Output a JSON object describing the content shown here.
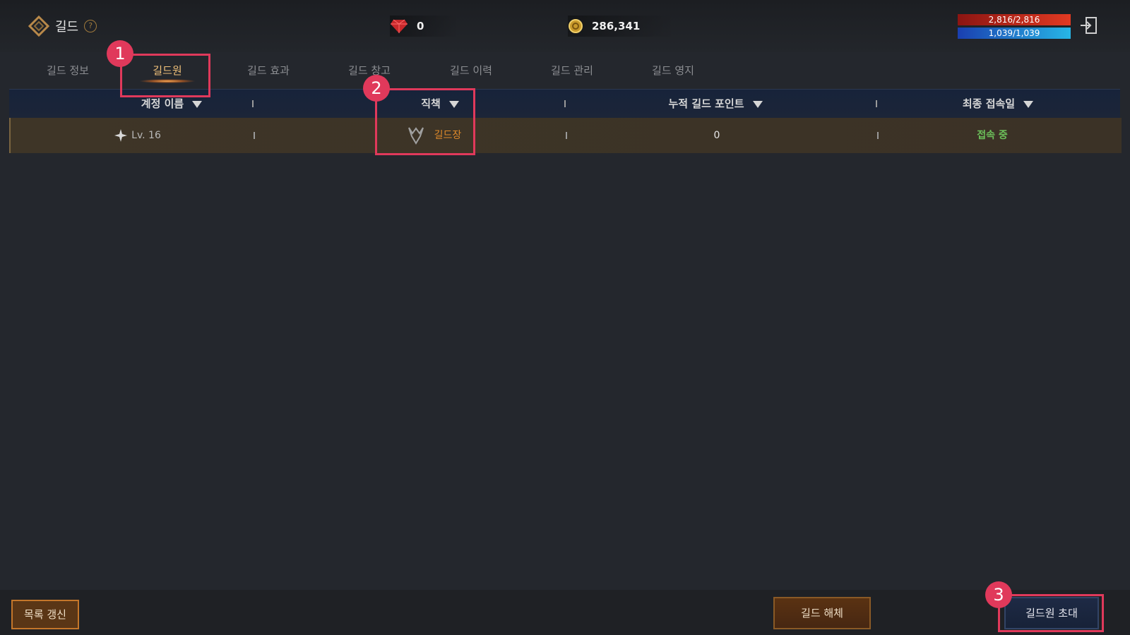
{
  "header": {
    "title": "길드",
    "help": "?",
    "gem_value": "0",
    "gold_value": "286,341",
    "hp": "2,816/2,816",
    "mp": "1,039/1,039"
  },
  "tabs": [
    "길드 정보",
    "길드원",
    "길드 효과",
    "길드 창고",
    "길드 이력",
    "길드 관리",
    "길드 영지"
  ],
  "active_tab": "길드원",
  "table": {
    "columns": [
      "계정 이름",
      "직책",
      "누적 길드 포인트",
      "최종 접속일"
    ],
    "rows": [
      {
        "account": "Lv. 16",
        "role": "길드장",
        "points": "0",
        "last_login": "접속 중"
      }
    ]
  },
  "footer": {
    "refresh": "목록 갱신",
    "dissolve": "길드 해체",
    "invite": "길드원 초대"
  },
  "annotations": [
    "1",
    "2",
    "3"
  ],
  "colors": {
    "highlight": "#e0395b",
    "role_text": "#e08a2a",
    "online_text": "#6cc05a",
    "active_tab": "#f2c27a"
  }
}
